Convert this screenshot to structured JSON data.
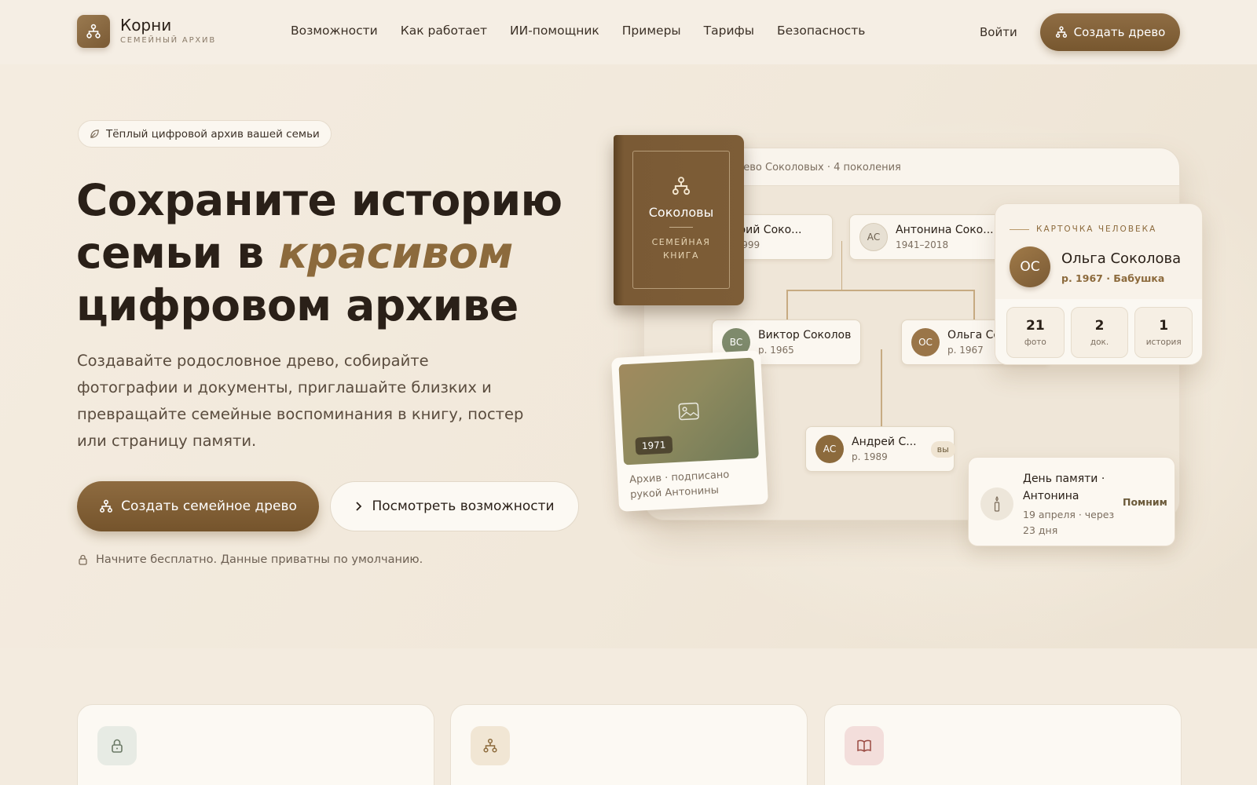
{
  "header": {
    "logo_title": "Корни",
    "logo_subtitle": "СЕМЕЙНЫЙ АРХИВ",
    "nav": [
      "Возможности",
      "Как работает",
      "ИИ-помощник",
      "Примеры",
      "Тарифы",
      "Безопасность"
    ],
    "login": "Войти",
    "create_button": "Создать древо"
  },
  "hero": {
    "tagline": "Тёплый цифровой архив вашей семьи",
    "title_line1": "Сохраните историю",
    "title_line2_start": "семьи в ",
    "title_accent": "красивом",
    "title_line3": "цифровом архиве",
    "lead": "Создавайте родословное древо, собирайте фотографии и документы, приглашайте близких и превращайте семейные воспоминания в книгу, постер или страницу памяти.",
    "primary_button": "Создать семейное древо",
    "secondary_button": "Посмотреть возможности",
    "note": "Начните бесплатно. Данные приватны по умолчанию."
  },
  "mock": {
    "breadcrumb": "рево Соколовых · 4 поколения",
    "people": [
      {
        "initials": "",
        "name": "итрий Соко...",
        "date": "8–1999"
      },
      {
        "initials": "АС",
        "name": "Антонина Соко...",
        "date": "1941–2018"
      },
      {
        "initials": "ВС",
        "name": "Виктор Соколов",
        "date": "р. 1965"
      },
      {
        "initials": "ОС",
        "name": "Ольга Со",
        "date": "р. 1967"
      },
      {
        "initials": "АС",
        "name": "Андрей С...",
        "date": "р. 1989",
        "badge": "вы"
      }
    ],
    "book": {
      "title": "Соколовы",
      "subtitle_line1": "СЕМЕЙНАЯ",
      "subtitle_line2": "КНИГА"
    },
    "photo": {
      "year": "1971",
      "caption": "Архив · подписано рукой Антонины"
    },
    "person_card": {
      "label": "КАРТОЧКА ЧЕЛОВЕКА",
      "initials": "ОС",
      "name": "Ольга Соколова",
      "meta": "р. 1967 · Бабушка",
      "stats": [
        {
          "value": "21",
          "label": "фото"
        },
        {
          "value": "2",
          "label": "док."
        },
        {
          "value": "1",
          "label": "история"
        }
      ]
    },
    "memorial": {
      "title": "День памяти · Антонина",
      "date": "19 апреля · через 23 дня",
      "action": "Помним"
    }
  },
  "features": {
    "icons": [
      "lock-icon",
      "tree-icon",
      "book-icon"
    ]
  },
  "colors": {
    "accent": "#8c6a3c",
    "button": "#7d5c33",
    "background": "#f3ebdf"
  }
}
